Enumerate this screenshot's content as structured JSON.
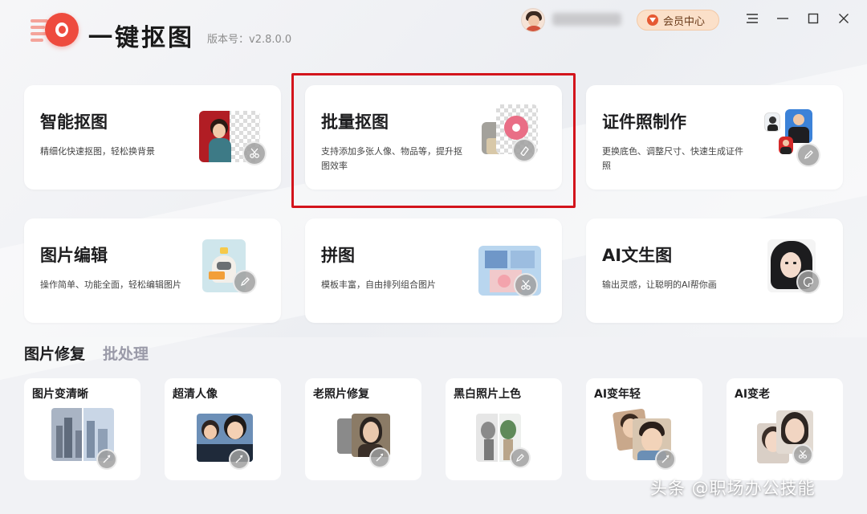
{
  "app": {
    "title": "一键抠图",
    "version": "版本号：v2.8.0.0"
  },
  "header": {
    "vip_label": "会员中心"
  },
  "window_controls": {
    "icons": [
      "menu-icon",
      "minimize-icon",
      "maximize-icon",
      "close-icon"
    ]
  },
  "features": [
    {
      "title": "智能抠图",
      "desc": "精细化快速抠图，轻松换背景"
    },
    {
      "title": "批量抠图",
      "desc": "支持添加多张人像、物品等，提升抠图效率"
    },
    {
      "title": "证件照制作",
      "desc": "更换底色、调整尺寸、快速生成证件照"
    },
    {
      "title": "图片编辑",
      "desc": "操作简单、功能全面，轻松编辑图片"
    },
    {
      "title": "拼图",
      "desc": "模板丰富，自由排列组合图片"
    },
    {
      "title": "AI文生图",
      "desc": "输出灵感，让聪明的AI帮你画"
    }
  ],
  "section_tabs": [
    "图片修复",
    "批处理"
  ],
  "tools": [
    {
      "title": "图片变清晰"
    },
    {
      "title": "超清人像"
    },
    {
      "title": "老照片修复"
    },
    {
      "title": "黑白照片上色"
    },
    {
      "title": "AI变年轻"
    },
    {
      "title": "AI变老"
    }
  ],
  "watermark": "头条 @职场办公技能",
  "colors": {
    "highlight_border": "#d3141c",
    "logo_red": "#ee4b3e",
    "vip_bg": "#fbe0c9",
    "inactive_tab": "#9a9aa8"
  }
}
